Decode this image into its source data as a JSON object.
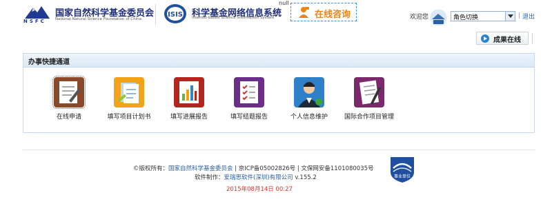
{
  "header": {
    "org_acronym": "NSFC",
    "org_name": "国家自然科学基金委员会",
    "org_name_en": "National Natural Science Foundation of China",
    "system_name": "科学基金网络信息系统",
    "system_name_en": "Internet-based Science Information System",
    "null_text": "null",
    "consult_label": "在线咨询",
    "welcome_text": "欢迎您",
    "role_select_value": "角色切换",
    "separator": "|",
    "logout_label": "退出"
  },
  "results_button": {
    "label": "成果在线"
  },
  "quick_panel": {
    "title": "办事快捷通道",
    "items": [
      {
        "label": "在线申请",
        "icon": "online-application-icon"
      },
      {
        "label": "填写项目计划书",
        "icon": "project-plan-icon"
      },
      {
        "label": "填写进展报告",
        "icon": "progress-report-icon"
      },
      {
        "label": "填写结题报告",
        "icon": "final-report-icon"
      },
      {
        "label": "个人信息维护",
        "icon": "personal-info-icon"
      },
      {
        "label": "国际合作项目管理",
        "icon": "international-cooperation-icon"
      }
    ]
  },
  "footer": {
    "copyright_prefix": "©版权所有：",
    "copyright_org": "国家自然科学基金委员会",
    "copyright_icp": " | 京ICP备05002826号 | 文保网安备1101080035号",
    "made_by_prefix": "软件制作：",
    "made_by_company": "爱瑞思软件(深圳)有限公司",
    "version": " v.155.2",
    "datetime": "2015年08月14日 00:27",
    "badge_text": "事业单位"
  },
  "colors": {
    "brand_blue": "#1f2f7a",
    "link_blue": "#2a5fa5",
    "consult_orange": "#e8861a",
    "date_red": "#e0322a",
    "panel_border": "#c6d8ea"
  }
}
